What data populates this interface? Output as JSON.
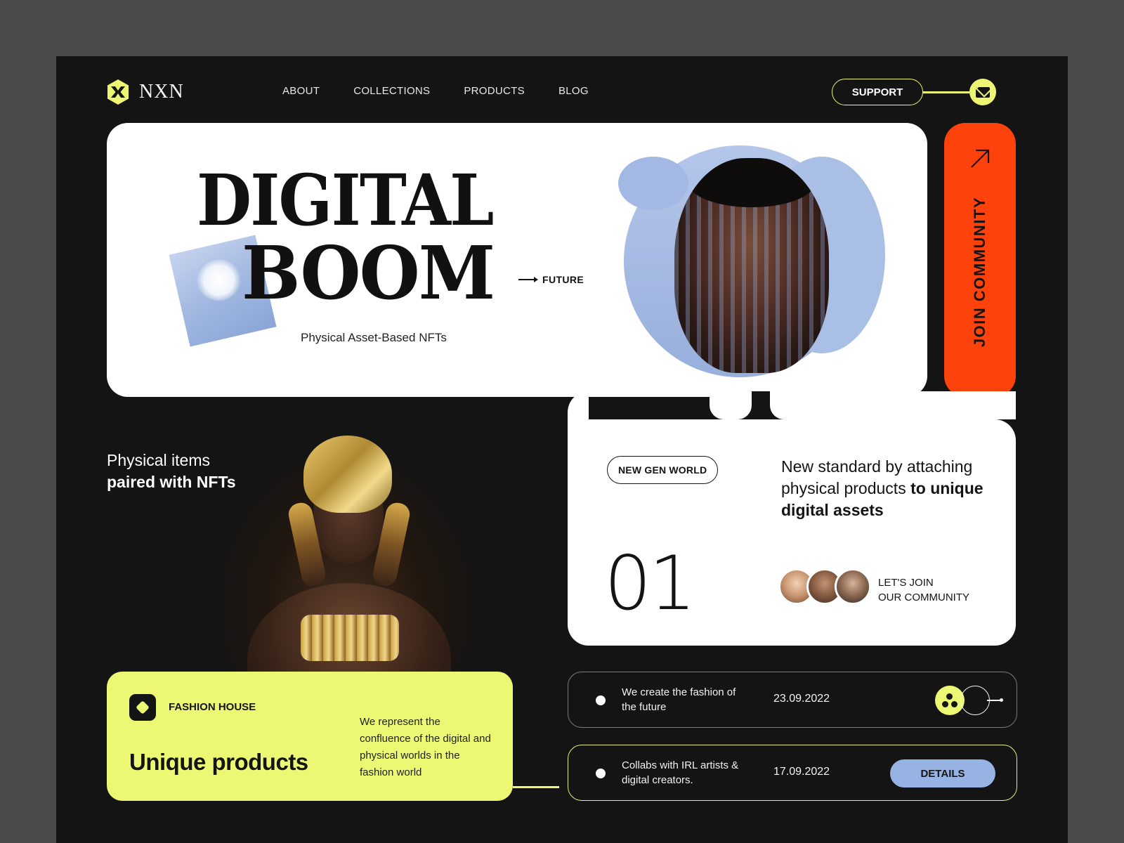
{
  "brand": {
    "name": "NXN",
    "accent": "#edf572",
    "orange": "#fd420c",
    "blue": "#97b3e3"
  },
  "nav": {
    "items": [
      "ABOUT",
      "COLLECTIONS",
      "PRODUCTS",
      "BLOG"
    ]
  },
  "header": {
    "support_label": "SUPPORT",
    "mail_icon": "mail-icon"
  },
  "hero": {
    "title_line1": "DIGITAL",
    "title_line2": "BOOM",
    "future_label": "FUTURE",
    "subtitle": "Physical Asset-Based NFTs"
  },
  "join": {
    "label": "JOIN COMMUNITY",
    "arrow_icon": "arrow-up-right-icon"
  },
  "physical": {
    "line1": "Physical items",
    "line2": "paired with NFTs"
  },
  "fashion": {
    "label": "FASHION HOUSE",
    "title": "Unique products",
    "description": "We represent the confluence of the digital and physical worlds in the fashion world"
  },
  "info": {
    "tag": "NEW GEN WORLD",
    "number": "01",
    "standard_plain": "New standard by attaching physical products ",
    "standard_bold": "to unique digital assets",
    "join_line1": "LET'S JOIN",
    "join_line2": "OUR COMMUNITY"
  },
  "rows": [
    {
      "text": "We create the fashion of the future",
      "date": "23.09.2022"
    },
    {
      "text": "Collabs with IRL artists & digital creators.",
      "date": "17.09.2022",
      "button": "DETAILS"
    }
  ]
}
